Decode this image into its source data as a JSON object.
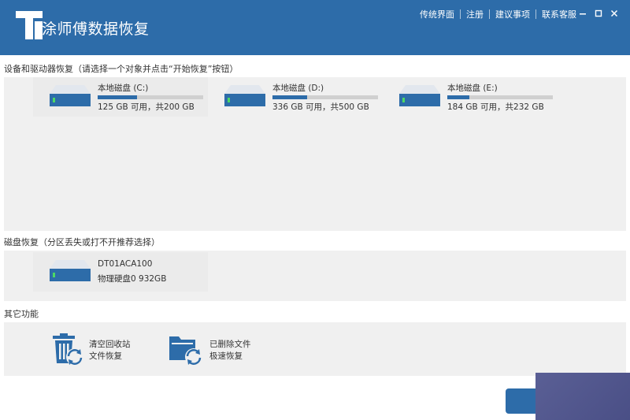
{
  "app": {
    "title": "涂师傅数据恢复",
    "logo_letter": "T"
  },
  "top_menu": {
    "items": [
      "传统界面",
      "注册",
      "建议事项",
      "联系客服"
    ]
  },
  "window_controls": [
    "minimize-icon",
    "maximize-icon",
    "close-icon"
  ],
  "sections": {
    "drives_label": "设备和驱动器恢复（请选择一个对象并点击“开始恢复”按钮）",
    "disks_label": "磁盘恢复（分区丢失或打不开推荐选择）",
    "other_label": "其它功能"
  },
  "drives": [
    {
      "name": "本地磁盘  (C:)",
      "info": "125 GB 可用，共200 GB",
      "used_fraction": 0.375
    },
    {
      "name": "本地磁盘  (D:)",
      "info": "336 GB 可用，共500 GB",
      "used_fraction": 0.328
    },
    {
      "name": "本地磁盘  (E:)",
      "info": "184 GB 可用，共232 GB",
      "used_fraction": 0.207
    }
  ],
  "physical_disks": [
    {
      "name": "DT01ACA100",
      "info": "物理硬盘0 932GB"
    }
  ],
  "functions": [
    {
      "line1": "清空回收站",
      "line2": "文件恢复",
      "icon": "recycle-bin-restore-icon"
    },
    {
      "line1": "已删除文件",
      "line2": "极速恢复",
      "icon": "folder-restore-icon"
    }
  ],
  "colors": {
    "accent": "#2d6ca9",
    "panel": "#f0f0f0",
    "overlay": "#4f5489"
  }
}
